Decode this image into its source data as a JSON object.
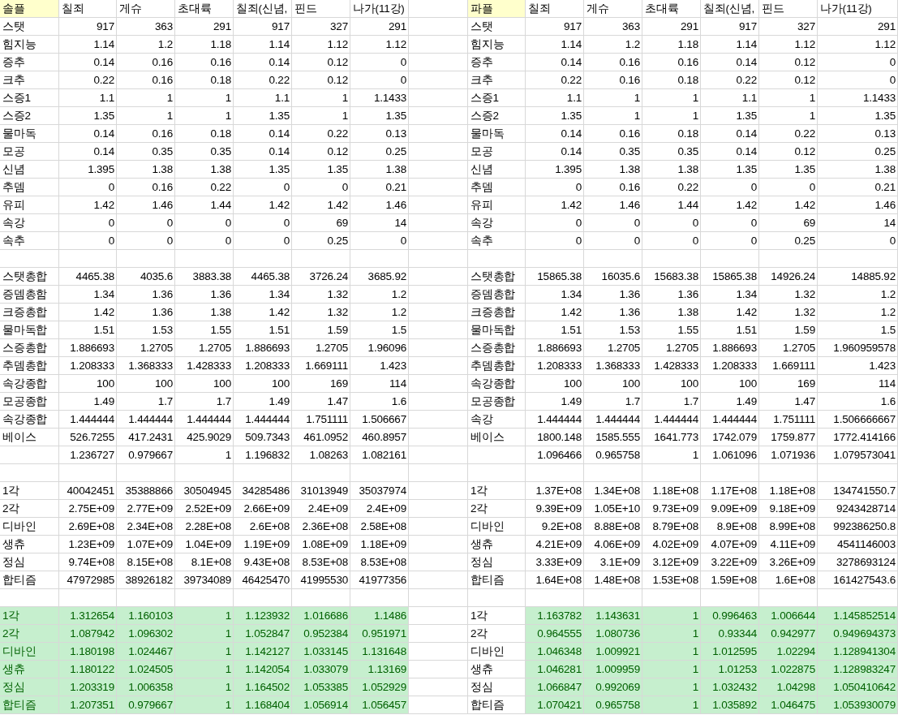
{
  "tables": [
    {
      "title": "솔플",
      "label_fill": true,
      "columns": [
        "칠죄",
        "게슈",
        "초대륙",
        "칠죄(신념,",
        "핀드",
        "나가(11강)"
      ],
      "rows": [
        {
          "kind": "data",
          "label": "스탯",
          "cells": [
            "917",
            "363",
            "291",
            "917",
            "327",
            "291"
          ]
        },
        {
          "kind": "data",
          "label": "힘지능",
          "cells": [
            "1.14",
            "1.2",
            "1.18",
            "1.14",
            "1.12",
            "1.12"
          ]
        },
        {
          "kind": "data",
          "label": "증추",
          "cells": [
            "0.14",
            "0.16",
            "0.16",
            "0.14",
            "0.12",
            "0"
          ]
        },
        {
          "kind": "data",
          "label": "크추",
          "cells": [
            "0.22",
            "0.16",
            "0.18",
            "0.22",
            "0.12",
            "0"
          ]
        },
        {
          "kind": "data",
          "label": "스증1",
          "cells": [
            "1.1",
            "1",
            "1",
            "1.1",
            "1",
            "1.1433"
          ]
        },
        {
          "kind": "data",
          "label": "스증2",
          "cells": [
            "1.35",
            "1",
            "1",
            "1.35",
            "1",
            "1.35"
          ]
        },
        {
          "kind": "data",
          "label": "물마독",
          "cells": [
            "0.14",
            "0.16",
            "0.18",
            "0.14",
            "0.22",
            "0.13"
          ]
        },
        {
          "kind": "data",
          "label": "모공",
          "cells": [
            "0.14",
            "0.35",
            "0.35",
            "0.14",
            "0.12",
            "0.25"
          ]
        },
        {
          "kind": "data",
          "label": "신념",
          "cells": [
            "1.395",
            "1.38",
            "1.38",
            "1.35",
            "1.35",
            "1.38"
          ]
        },
        {
          "kind": "data",
          "label": "추뎀",
          "cells": [
            "0",
            "0.16",
            "0.22",
            "0",
            "0",
            "0.21"
          ]
        },
        {
          "kind": "data",
          "label": "유피",
          "cells": [
            "1.42",
            "1.46",
            "1.44",
            "1.42",
            "1.42",
            "1.46"
          ]
        },
        {
          "kind": "data",
          "label": "속강",
          "cells": [
            "0",
            "0",
            "0",
            "0",
            "69",
            "14"
          ]
        },
        {
          "kind": "data",
          "label": "속추",
          "cells": [
            "0",
            "0",
            "0",
            "0",
            "0.25",
            "0"
          ]
        },
        {
          "kind": "blank"
        },
        {
          "kind": "data",
          "label": "스탯총합",
          "cells": [
            "4465.38",
            "4035.6",
            "3883.38",
            "4465.38",
            "3726.24",
            "3685.92"
          ]
        },
        {
          "kind": "data",
          "label": "증뎀총함",
          "cells": [
            "1.34",
            "1.36",
            "1.36",
            "1.34",
            "1.32",
            "1.2"
          ]
        },
        {
          "kind": "data",
          "label": "크증총합",
          "cells": [
            "1.42",
            "1.36",
            "1.38",
            "1.42",
            "1.32",
            "1.2"
          ]
        },
        {
          "kind": "data",
          "label": "물마독합",
          "cells": [
            "1.51",
            "1.53",
            "1.55",
            "1.51",
            "1.59",
            "1.5"
          ]
        },
        {
          "kind": "data",
          "label": "스증총합",
          "cells": [
            "1.886693",
            "1.2705",
            "1.2705",
            "1.886693",
            "1.2705",
            "1.96096"
          ]
        },
        {
          "kind": "data",
          "label": "추뎀총합",
          "cells": [
            "1.208333",
            "1.368333",
            "1.428333",
            "1.208333",
            "1.669111",
            "1.423"
          ]
        },
        {
          "kind": "data",
          "label": "속강종합",
          "cells": [
            "100",
            "100",
            "100",
            "100",
            "169",
            "114"
          ]
        },
        {
          "kind": "data",
          "label": "모공종합",
          "cells": [
            "1.49",
            "1.7",
            "1.7",
            "1.49",
            "1.47",
            "1.6"
          ]
        },
        {
          "kind": "data",
          "label": "속강종합",
          "cells": [
            "1.444444",
            "1.444444",
            "1.444444",
            "1.444444",
            "1.751111",
            "1.506667"
          ]
        },
        {
          "kind": "data",
          "label": "베이스",
          "cells": [
            "526.7255",
            "417.2431",
            "425.9029",
            "509.7343",
            "461.0952",
            "460.8957"
          ]
        },
        {
          "kind": "data",
          "cells": [
            "1.236727",
            "0.979667",
            "1",
            "1.196832",
            "1.08263",
            "1.082161"
          ]
        },
        {
          "kind": "blank"
        },
        {
          "kind": "data",
          "label": "1각",
          "cells": [
            "40042451",
            "35388866",
            "30504945",
            "34285486",
            "31013949",
            "35037974"
          ]
        },
        {
          "kind": "data",
          "label": "2각",
          "cells": [
            "2.75E+09",
            "2.77E+09",
            "2.52E+09",
            "2.66E+09",
            "2.4E+09",
            "2.4E+09"
          ]
        },
        {
          "kind": "data",
          "label": "디바인",
          "cells": [
            "2.69E+08",
            "2.34E+08",
            "2.28E+08",
            "2.6E+08",
            "2.36E+08",
            "2.58E+08"
          ]
        },
        {
          "kind": "data",
          "label": "생츄",
          "cells": [
            "1.23E+09",
            "1.07E+09",
            "1.04E+09",
            "1.19E+09",
            "1.08E+09",
            "1.18E+09"
          ]
        },
        {
          "kind": "data",
          "label": "정심",
          "cells": [
            "9.74E+08",
            "8.15E+08",
            "8.1E+08",
            "9.43E+08",
            "8.53E+08",
            "8.53E+08"
          ]
        },
        {
          "kind": "data",
          "label": "합티즘",
          "cells": [
            "47972985",
            "38926182",
            "39734089",
            "46425470",
            "41995530",
            "41977356"
          ]
        },
        {
          "kind": "blank"
        },
        {
          "kind": "highlight",
          "label": "1각",
          "cells": [
            "1.312654",
            "1.160103",
            "1",
            "1.123932",
            "1.016686",
            "1.1486"
          ]
        },
        {
          "kind": "highlight",
          "label": "2각",
          "cells": [
            "1.087942",
            "1.096302",
            "1",
            "1.052847",
            "0.952384",
            "0.951971"
          ]
        },
        {
          "kind": "highlight",
          "label": "디바인",
          "cells": [
            "1.180198",
            "1.024467",
            "1",
            "1.142127",
            "1.033145",
            "1.131648"
          ]
        },
        {
          "kind": "highlight",
          "label": "생츄",
          "cells": [
            "1.180122",
            "1.024505",
            "1",
            "1.142054",
            "1.033079",
            "1.13169"
          ]
        },
        {
          "kind": "highlight",
          "label": "정심",
          "cells": [
            "1.203319",
            "1.006358",
            "1",
            "1.164502",
            "1.053385",
            "1.052929"
          ]
        },
        {
          "kind": "highlight",
          "label": "합티즘",
          "cells": [
            "1.207351",
            "0.979667",
            "1",
            "1.168404",
            "1.056914",
            "1.056457"
          ]
        }
      ]
    },
    {
      "title": "파플",
      "label_fill": false,
      "columns": [
        "칠죄",
        "게슈",
        "초대륙",
        "칠죄(신념,",
        "핀드",
        "나가(11강)"
      ],
      "rows": [
        {
          "kind": "data",
          "label": "스탯",
          "cells": [
            "917",
            "363",
            "291",
            "917",
            "327",
            "291"
          ]
        },
        {
          "kind": "data",
          "label": "힘지능",
          "cells": [
            "1.14",
            "1.2",
            "1.18",
            "1.14",
            "1.12",
            "1.12"
          ]
        },
        {
          "kind": "data",
          "label": "증추",
          "cells": [
            "0.14",
            "0.16",
            "0.16",
            "0.14",
            "0.12",
            "0"
          ]
        },
        {
          "kind": "data",
          "label": "크추",
          "cells": [
            "0.22",
            "0.16",
            "0.18",
            "0.22",
            "0.12",
            "0"
          ]
        },
        {
          "kind": "data",
          "label": "스증1",
          "cells": [
            "1.1",
            "1",
            "1",
            "1.1",
            "1",
            "1.1433"
          ]
        },
        {
          "kind": "data",
          "label": "스증2",
          "cells": [
            "1.35",
            "1",
            "1",
            "1.35",
            "1",
            "1.35"
          ]
        },
        {
          "kind": "data",
          "label": "물마독",
          "cells": [
            "0.14",
            "0.16",
            "0.18",
            "0.14",
            "0.22",
            "0.13"
          ]
        },
        {
          "kind": "data",
          "label": "모공",
          "cells": [
            "0.14",
            "0.35",
            "0.35",
            "0.14",
            "0.12",
            "0.25"
          ]
        },
        {
          "kind": "data",
          "label": "신념",
          "cells": [
            "1.395",
            "1.38",
            "1.38",
            "1.35",
            "1.35",
            "1.38"
          ]
        },
        {
          "kind": "data",
          "label": "추뎀",
          "cells": [
            "0",
            "0.16",
            "0.22",
            "0",
            "0",
            "0.21"
          ]
        },
        {
          "kind": "data",
          "label": "유피",
          "cells": [
            "1.42",
            "1.46",
            "1.44",
            "1.42",
            "1.42",
            "1.46"
          ]
        },
        {
          "kind": "data",
          "label": "속강",
          "cells": [
            "0",
            "0",
            "0",
            "0",
            "69",
            "14"
          ]
        },
        {
          "kind": "data",
          "label": "속추",
          "cells": [
            "0",
            "0",
            "0",
            "0",
            "0.25",
            "0"
          ]
        },
        {
          "kind": "blank"
        },
        {
          "kind": "data",
          "label": "스탯총합",
          "cells": [
            "15865.38",
            "16035.6",
            "15683.38",
            "15865.38",
            "14926.24",
            "14885.92"
          ]
        },
        {
          "kind": "data",
          "label": "증뎀총합",
          "cells": [
            "1.34",
            "1.36",
            "1.36",
            "1.34",
            "1.32",
            "1.2"
          ]
        },
        {
          "kind": "data",
          "label": "크증총합",
          "cells": [
            "1.42",
            "1.36",
            "1.38",
            "1.42",
            "1.32",
            "1.2"
          ]
        },
        {
          "kind": "data",
          "label": "물마독합",
          "cells": [
            "1.51",
            "1.53",
            "1.55",
            "1.51",
            "1.59",
            "1.5"
          ]
        },
        {
          "kind": "data",
          "label": "스증총합",
          "cells": [
            "1.886693",
            "1.2705",
            "1.2705",
            "1.886693",
            "1.2705",
            "1.960959578"
          ]
        },
        {
          "kind": "data",
          "label": "추뎀총합",
          "cells": [
            "1.208333",
            "1.368333",
            "1.428333",
            "1.208333",
            "1.669111",
            "1.423"
          ]
        },
        {
          "kind": "data",
          "label": "속강종합",
          "cells": [
            "100",
            "100",
            "100",
            "100",
            "169",
            "114"
          ]
        },
        {
          "kind": "data",
          "label": "모공종합",
          "cells": [
            "1.49",
            "1.7",
            "1.7",
            "1.49",
            "1.47",
            "1.6"
          ]
        },
        {
          "kind": "data",
          "label": "속강",
          "cells": [
            "1.444444",
            "1.444444",
            "1.444444",
            "1.444444",
            "1.751111",
            "1.506666667"
          ]
        },
        {
          "kind": "data",
          "label": "베이스",
          "cells": [
            "1800.148",
            "1585.555",
            "1641.773",
            "1742.079",
            "1759.877",
            "1772.414166"
          ]
        },
        {
          "kind": "data",
          "cells": [
            "1.096466",
            "0.965758",
            "1",
            "1.061096",
            "1.071936",
            "1.079573041"
          ]
        },
        {
          "kind": "blank"
        },
        {
          "kind": "data",
          "label": "1각",
          "cells": [
            "1.37E+08",
            "1.34E+08",
            "1.18E+08",
            "1.17E+08",
            "1.18E+08",
            "134741550.7"
          ]
        },
        {
          "kind": "data",
          "label": "2각",
          "cells": [
            "9.39E+09",
            "1.05E+10",
            "9.73E+09",
            "9.09E+09",
            "9.18E+09",
            "9243428714"
          ]
        },
        {
          "kind": "data",
          "label": "디바인",
          "cells": [
            "9.2E+08",
            "8.88E+08",
            "8.79E+08",
            "8.9E+08",
            "8.99E+08",
            "992386250.8"
          ]
        },
        {
          "kind": "data",
          "label": "생츄",
          "cells": [
            "4.21E+09",
            "4.06E+09",
            "4.02E+09",
            "4.07E+09",
            "4.11E+09",
            "4541146003"
          ]
        },
        {
          "kind": "data",
          "label": "정심",
          "cells": [
            "3.33E+09",
            "3.1E+09",
            "3.12E+09",
            "3.22E+09",
            "3.26E+09",
            "3278693124"
          ]
        },
        {
          "kind": "data",
          "label": "합티즘",
          "cells": [
            "1.64E+08",
            "1.48E+08",
            "1.53E+08",
            "1.59E+08",
            "1.6E+08",
            "161427543.6"
          ]
        },
        {
          "kind": "blank"
        },
        {
          "kind": "highlight",
          "label": "1각",
          "cells": [
            "1.163782",
            "1.143631",
            "1",
            "0.996463",
            "1.006644",
            "1.145852514"
          ]
        },
        {
          "kind": "highlight",
          "label": "2각",
          "cells": [
            "0.964555",
            "1.080736",
            "1",
            "0.93344",
            "0.942977",
            "0.949694373"
          ]
        },
        {
          "kind": "highlight",
          "label": "디바인",
          "cells": [
            "1.046348",
            "1.009921",
            "1",
            "1.012595",
            "1.02294",
            "1.128941304"
          ]
        },
        {
          "kind": "highlight",
          "label": "생츄",
          "cells": [
            "1.046281",
            "1.009959",
            "1",
            "1.01253",
            "1.022875",
            "1.128983247"
          ]
        },
        {
          "kind": "highlight",
          "label": "정심",
          "cells": [
            "1.066847",
            "0.992069",
            "1",
            "1.032432",
            "1.04298",
            "1.050410642"
          ]
        },
        {
          "kind": "highlight",
          "label": "합티즘",
          "cells": [
            "1.070421",
            "0.965758",
            "1",
            "1.035892",
            "1.046475",
            "1.053930079"
          ]
        }
      ]
    }
  ]
}
